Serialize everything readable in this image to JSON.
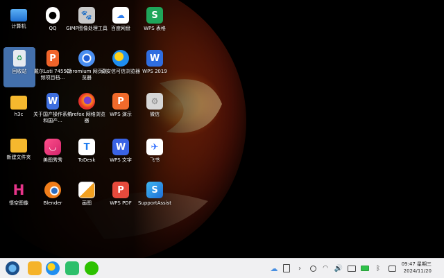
{
  "desktop": {
    "icons": [
      {
        "label": "计算机",
        "icon": "computer-icon"
      },
      {
        "label": "QQ",
        "icon": "qq-icon"
      },
      {
        "label": "GIMP图像处理工具",
        "icon": "gimp-icon"
      },
      {
        "label": "百度网盘",
        "icon": "baidu-netdisk-icon"
      },
      {
        "label": "WPS 表格",
        "icon": "wps-sheet-icon"
      },
      {
        "label": "回收站",
        "icon": "recycle-bin-icon"
      },
      {
        "label": "戴尔Lati 7455视频项目档...",
        "icon": "wps-pdf-file-icon"
      },
      {
        "label": "Chromium 网页浏览器",
        "icon": "chromium-icon"
      },
      {
        "label": "奇安信可信浏览器",
        "icon": "qianxin-browser-icon"
      },
      {
        "label": "WPS 2019",
        "icon": "wps-2019-icon"
      },
      {
        "label": "h3c",
        "icon": "folder-icon"
      },
      {
        "label": "关于国产操作系统和国产...",
        "icon": "wps-doc-file-icon"
      },
      {
        "label": "Firefox 网络浏览器",
        "icon": "firefox-icon"
      },
      {
        "label": "WPS 演示",
        "icon": "wps-presentation-icon"
      },
      {
        "label": "微信",
        "icon": "wechat-icon"
      },
      {
        "label": "新建文件夹",
        "icon": "folder-icon"
      },
      {
        "label": "美图秀秀",
        "icon": "meitu-icon"
      },
      {
        "label": "ToDesk",
        "icon": "todesk-icon"
      },
      {
        "label": "WPS 文字",
        "icon": "wps-writer-icon"
      },
      {
        "label": "飞书",
        "icon": "feishu-icon"
      },
      {
        "label": "悟空图像",
        "icon": "wukong-image-icon"
      },
      {
        "label": "Blender",
        "icon": "blender-icon"
      },
      {
        "label": "画图",
        "icon": "paint-icon"
      },
      {
        "label": "WPS PDF",
        "icon": "wps-pdf-icon"
      },
      {
        "label": "SupportAssist",
        "icon": "supportassist-icon"
      }
    ]
  },
  "taskbar": {
    "apps": [
      "launcher-icon",
      "file-manager-icon",
      "browser-icon",
      "app-store-icon",
      "wechat-icon"
    ],
    "tray": [
      "cloud-icon",
      "clipboard-icon",
      "chevron-right-icon",
      "search-icon",
      "wifi-icon",
      "volume-icon",
      "keyboard-icon",
      "battery-icon",
      "bluetooth-icon",
      "notification-icon"
    ],
    "time": "09:47 星期三",
    "date": "2024/11/20"
  },
  "colors": {
    "selection": "#5a96e6",
    "taskbar_bg": "#f0f0f2",
    "wallpaper_orange": "#e8641a"
  }
}
